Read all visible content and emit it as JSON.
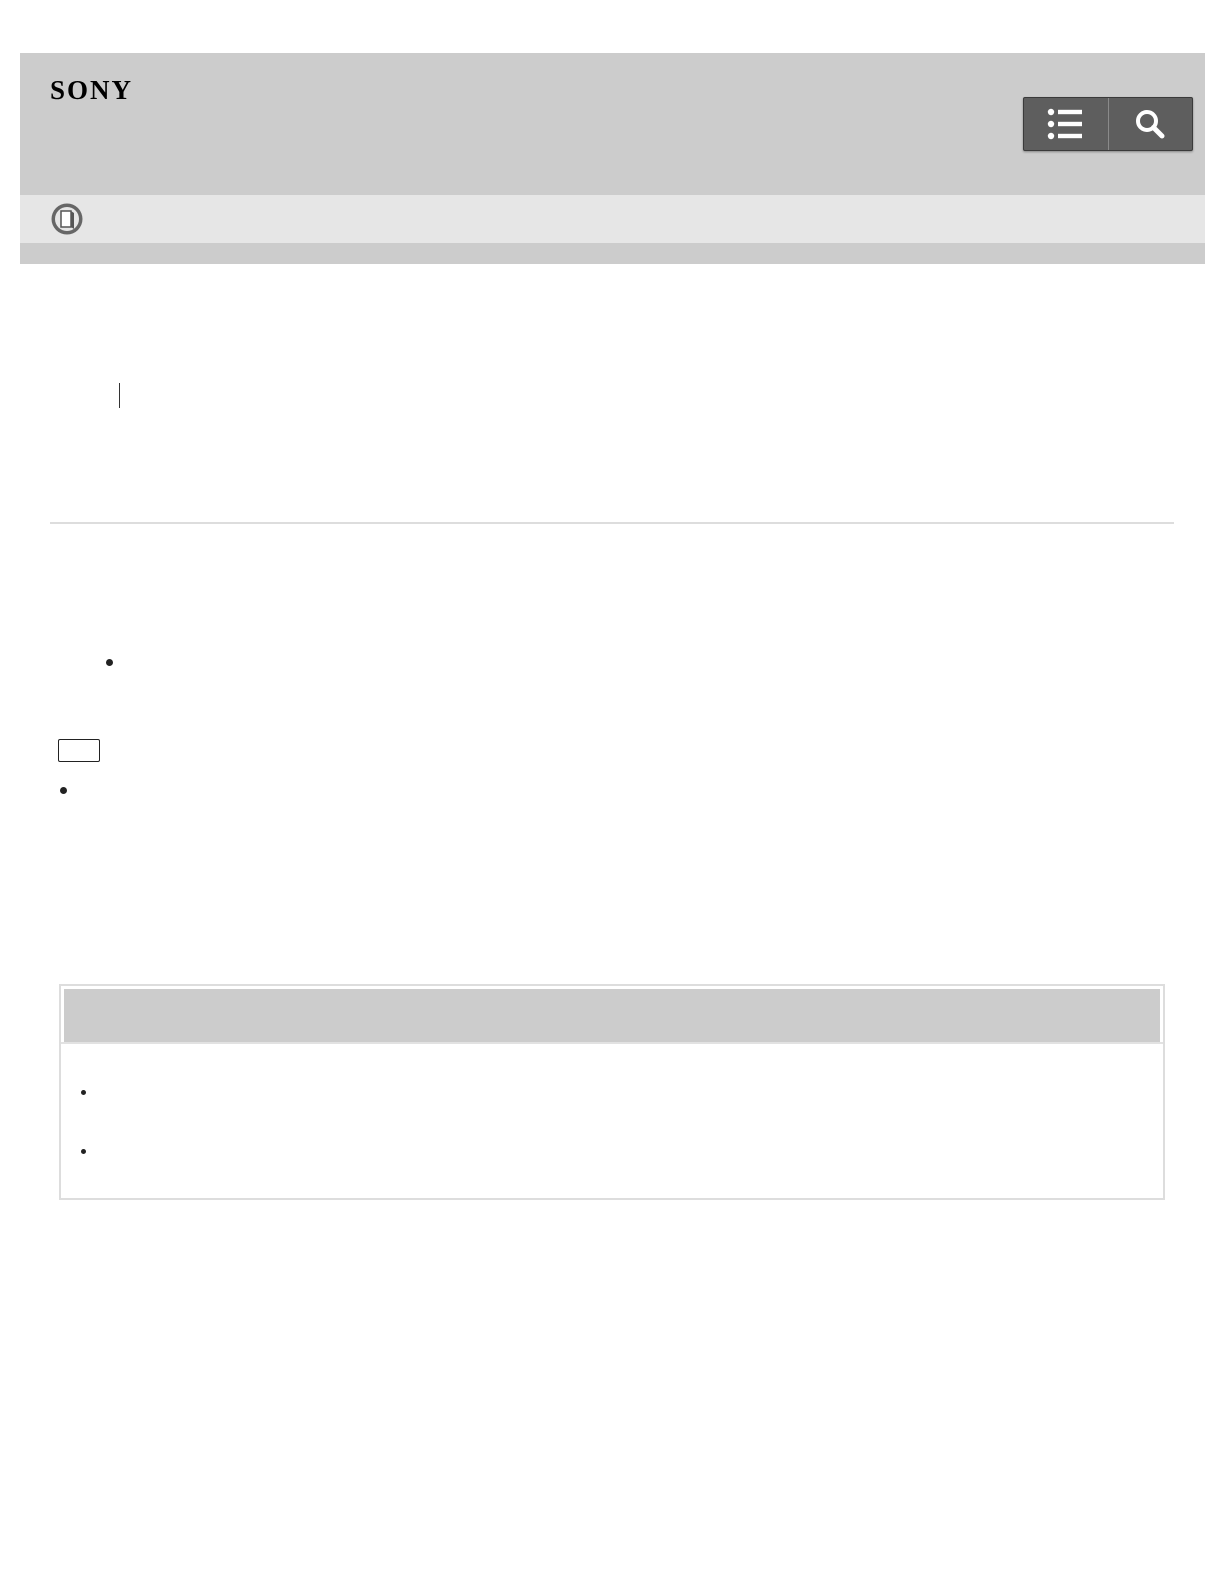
{
  "header": {
    "brand": "SONY",
    "toc_button_icon": "list-icon",
    "search_button_icon": "search-icon"
  },
  "subbar": {
    "icon": "manual-book-icon"
  },
  "colors": {
    "header_bg": "#cccccc",
    "subbar_bg": "#e6e6e6",
    "button_bg": "#5e5e5e",
    "button_icon": "#ffffff",
    "divider": "#dddddd"
  }
}
